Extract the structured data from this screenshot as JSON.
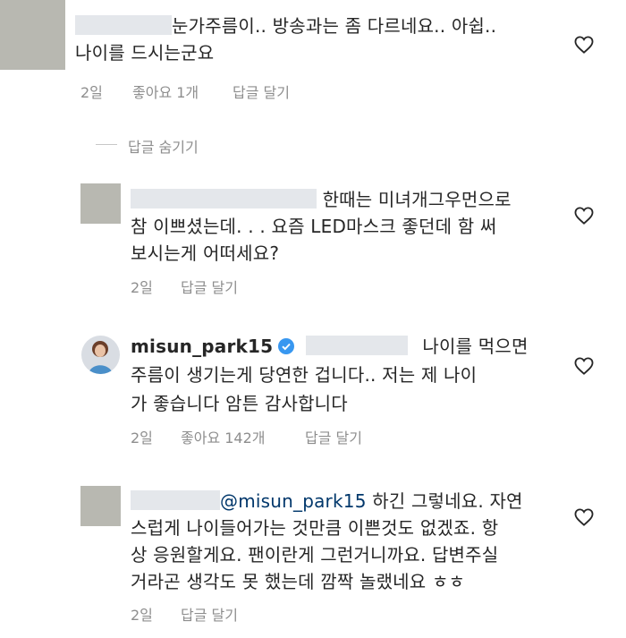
{
  "comments": [
    {
      "lines": [
        "눈가주름이.. 방송과는 좀 다르네요.. 아쉽..",
        "나이를 드시는군요"
      ],
      "time": "2일",
      "likes": "좋아요 1개",
      "reply": "답글 달기"
    },
    {
      "lines": [
        "한때는 미녀개그우먼으로",
        "참 이쁘셨는데. . . 요즘 LED마스크 좋던데 함 써",
        "보시는게 어떠세요?"
      ],
      "time": "2일",
      "reply": "답글 달기"
    },
    {
      "username": "misun_park15",
      "lines": [
        "나이를 먹으면",
        "주름이 생기는게 당연한 겁니다.. 저는 제 나이",
        "가 좋습니다 암튼 감사합니다"
      ],
      "time": "2일",
      "likes": "좋아요 142개",
      "reply": "답글 달기"
    },
    {
      "mention": "@misun_park15",
      "lines": [
        "하긴 그렇네요. 자연",
        "스럽게 나이들어가는 것만큼 이쁜것도 없겠죠. 항",
        "상 응원할게요. 팬이란게 그런거니까요. 답변주실",
        "거라곤 생각도 못 했는데 깜짝 놀랬네요 ㅎㅎ"
      ],
      "time": "2일",
      "reply": "답글 달기"
    }
  ],
  "hide_replies": "답글 숨기기",
  "colors": {
    "text": "#262626",
    "meta": "#8e8e8e",
    "mention": "#00376b",
    "verified": "#3897f0",
    "redaction": "#e4e7eb"
  },
  "icons": {
    "like": "heart-outline-icon",
    "verified": "verified-badge-icon"
  }
}
